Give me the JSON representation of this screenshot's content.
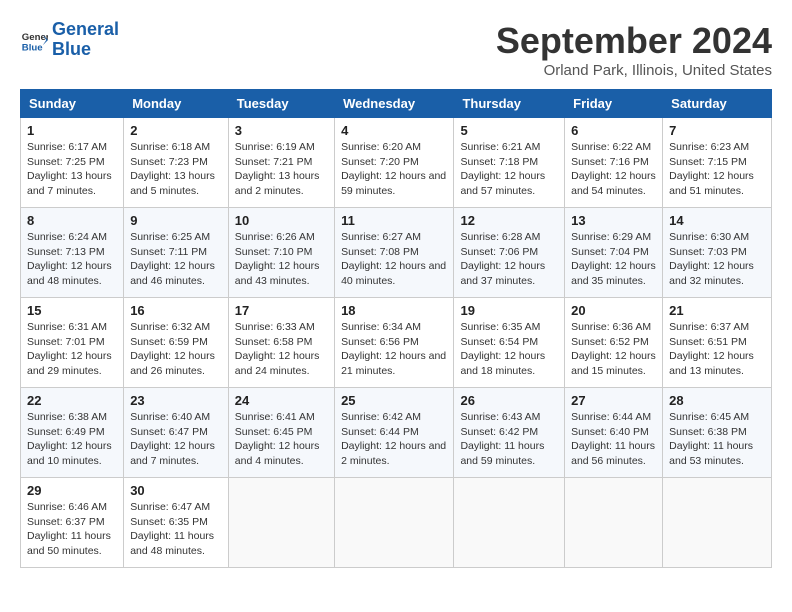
{
  "header": {
    "logo_line1": "General",
    "logo_line2": "Blue",
    "month": "September 2024",
    "location": "Orland Park, Illinois, United States"
  },
  "columns": [
    "Sunday",
    "Monday",
    "Tuesday",
    "Wednesday",
    "Thursday",
    "Friday",
    "Saturday"
  ],
  "weeks": [
    [
      {
        "day": "1",
        "text": "Sunrise: 6:17 AM\nSunset: 7:25 PM\nDaylight: 13 hours and 7 minutes."
      },
      {
        "day": "2",
        "text": "Sunrise: 6:18 AM\nSunset: 7:23 PM\nDaylight: 13 hours and 5 minutes."
      },
      {
        "day": "3",
        "text": "Sunrise: 6:19 AM\nSunset: 7:21 PM\nDaylight: 13 hours and 2 minutes."
      },
      {
        "day": "4",
        "text": "Sunrise: 6:20 AM\nSunset: 7:20 PM\nDaylight: 12 hours and 59 minutes."
      },
      {
        "day": "5",
        "text": "Sunrise: 6:21 AM\nSunset: 7:18 PM\nDaylight: 12 hours and 57 minutes."
      },
      {
        "day": "6",
        "text": "Sunrise: 6:22 AM\nSunset: 7:16 PM\nDaylight: 12 hours and 54 minutes."
      },
      {
        "day": "7",
        "text": "Sunrise: 6:23 AM\nSunset: 7:15 PM\nDaylight: 12 hours and 51 minutes."
      }
    ],
    [
      {
        "day": "8",
        "text": "Sunrise: 6:24 AM\nSunset: 7:13 PM\nDaylight: 12 hours and 48 minutes."
      },
      {
        "day": "9",
        "text": "Sunrise: 6:25 AM\nSunset: 7:11 PM\nDaylight: 12 hours and 46 minutes."
      },
      {
        "day": "10",
        "text": "Sunrise: 6:26 AM\nSunset: 7:10 PM\nDaylight: 12 hours and 43 minutes."
      },
      {
        "day": "11",
        "text": "Sunrise: 6:27 AM\nSunset: 7:08 PM\nDaylight: 12 hours and 40 minutes."
      },
      {
        "day": "12",
        "text": "Sunrise: 6:28 AM\nSunset: 7:06 PM\nDaylight: 12 hours and 37 minutes."
      },
      {
        "day": "13",
        "text": "Sunrise: 6:29 AM\nSunset: 7:04 PM\nDaylight: 12 hours and 35 minutes."
      },
      {
        "day": "14",
        "text": "Sunrise: 6:30 AM\nSunset: 7:03 PM\nDaylight: 12 hours and 32 minutes."
      }
    ],
    [
      {
        "day": "15",
        "text": "Sunrise: 6:31 AM\nSunset: 7:01 PM\nDaylight: 12 hours and 29 minutes."
      },
      {
        "day": "16",
        "text": "Sunrise: 6:32 AM\nSunset: 6:59 PM\nDaylight: 12 hours and 26 minutes."
      },
      {
        "day": "17",
        "text": "Sunrise: 6:33 AM\nSunset: 6:58 PM\nDaylight: 12 hours and 24 minutes."
      },
      {
        "day": "18",
        "text": "Sunrise: 6:34 AM\nSunset: 6:56 PM\nDaylight: 12 hours and 21 minutes."
      },
      {
        "day": "19",
        "text": "Sunrise: 6:35 AM\nSunset: 6:54 PM\nDaylight: 12 hours and 18 minutes."
      },
      {
        "day": "20",
        "text": "Sunrise: 6:36 AM\nSunset: 6:52 PM\nDaylight: 12 hours and 15 minutes."
      },
      {
        "day": "21",
        "text": "Sunrise: 6:37 AM\nSunset: 6:51 PM\nDaylight: 12 hours and 13 minutes."
      }
    ],
    [
      {
        "day": "22",
        "text": "Sunrise: 6:38 AM\nSunset: 6:49 PM\nDaylight: 12 hours and 10 minutes."
      },
      {
        "day": "23",
        "text": "Sunrise: 6:40 AM\nSunset: 6:47 PM\nDaylight: 12 hours and 7 minutes."
      },
      {
        "day": "24",
        "text": "Sunrise: 6:41 AM\nSunset: 6:45 PM\nDaylight: 12 hours and 4 minutes."
      },
      {
        "day": "25",
        "text": "Sunrise: 6:42 AM\nSunset: 6:44 PM\nDaylight: 12 hours and 2 minutes."
      },
      {
        "day": "26",
        "text": "Sunrise: 6:43 AM\nSunset: 6:42 PM\nDaylight: 11 hours and 59 minutes."
      },
      {
        "day": "27",
        "text": "Sunrise: 6:44 AM\nSunset: 6:40 PM\nDaylight: 11 hours and 56 minutes."
      },
      {
        "day": "28",
        "text": "Sunrise: 6:45 AM\nSunset: 6:38 PM\nDaylight: 11 hours and 53 minutes."
      }
    ],
    [
      {
        "day": "29",
        "text": "Sunrise: 6:46 AM\nSunset: 6:37 PM\nDaylight: 11 hours and 50 minutes."
      },
      {
        "day": "30",
        "text": "Sunrise: 6:47 AM\nSunset: 6:35 PM\nDaylight: 11 hours and 48 minutes."
      },
      {
        "day": "",
        "text": ""
      },
      {
        "day": "",
        "text": ""
      },
      {
        "day": "",
        "text": ""
      },
      {
        "day": "",
        "text": ""
      },
      {
        "day": "",
        "text": ""
      }
    ]
  ]
}
